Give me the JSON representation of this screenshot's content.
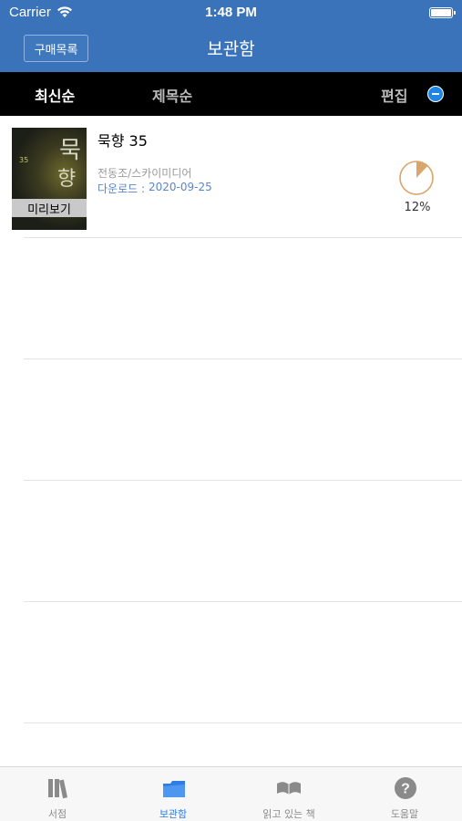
{
  "status_bar": {
    "carrier": "Carrier",
    "time": "1:48 PM"
  },
  "nav": {
    "left_button": "구매목록",
    "title": "보관함"
  },
  "sort_bar": {
    "latest": "최신순",
    "by_title": "제목순",
    "edit": "편집"
  },
  "books": [
    {
      "title": "묵향 35",
      "author": "전동조/스카이미디어",
      "download_label": "다운로드 :",
      "download_date": "2020-09-25",
      "preview_label": "미리보기",
      "cover_text_1": "묵",
      "cover_text_2": "향",
      "cover_number": "35",
      "progress": 12,
      "progress_text": "12%"
    }
  ],
  "tabs": [
    {
      "label": "서점",
      "icon": "books-icon",
      "active": false
    },
    {
      "label": "보관함",
      "icon": "folder-icon",
      "active": true
    },
    {
      "label": "읽고 있는 책",
      "icon": "open-book-icon",
      "active": false
    },
    {
      "label": "도움말",
      "icon": "help-icon",
      "active": false
    }
  ],
  "colors": {
    "header": "#3a73b9",
    "accent": "#2f7ee6",
    "progress": "#d9a56a"
  }
}
